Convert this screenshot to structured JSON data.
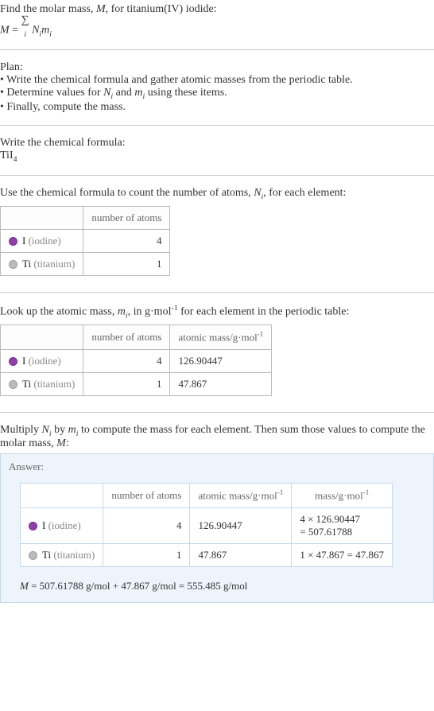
{
  "intro": {
    "line1_a": "Find the molar mass, ",
    "line1_b": ", for titanium(IV) iodide:",
    "formula_lhs": "M",
    "formula_eq": " = ",
    "formula_sum_top": "∑",
    "formula_sum_sub": "i",
    "formula_rhs_a": " N",
    "formula_rhs_b": "m"
  },
  "plan": {
    "heading": "Plan:",
    "b1_a": "• Write the chemical formula and gather atomic masses from the periodic table.",
    "b2_a": "• Determine values for ",
    "b2_b": " and ",
    "b2_c": " using these items.",
    "b3": "• Finally, compute the mass."
  },
  "step_formula": {
    "heading": "Write the chemical formula:",
    "formula_a": "TiI",
    "formula_sub": "4"
  },
  "step_count": {
    "heading_a": "Use the chemical formula to count the number of atoms, ",
    "heading_b": ", for each element:"
  },
  "step_mass": {
    "heading_a": "Look up the atomic mass, ",
    "heading_b": ", in g·mol",
    "heading_c": " for each element in the periodic table:"
  },
  "step_mult": {
    "heading_a": "Multiply ",
    "heading_b": " by ",
    "heading_c": " to compute the mass for each element. Then sum those values to compute the molar mass, ",
    "heading_d": ":"
  },
  "symbols": {
    "M": "M",
    "N": "N",
    "m": "m",
    "i": "i",
    "neg1": "-1"
  },
  "headers": {
    "number_of_atoms": "number of atoms",
    "atomic_mass": "atomic mass/g·mol",
    "mass": "mass/g·mol"
  },
  "elements": {
    "iodine_sym": "I",
    "iodine_name": "(iodine)",
    "titanium_sym": "Ti",
    "titanium_name": "(titanium)"
  },
  "chart_data": {
    "type": "table",
    "rows": [
      {
        "element": "I (iodine)",
        "atoms": 4,
        "atomic_mass": 126.90447,
        "mass_expr": "4 × 126.90447 = 507.61788"
      },
      {
        "element": "Ti (titanium)",
        "atoms": 1,
        "atomic_mass": 47.867,
        "mass_expr": "1 × 47.867 = 47.867"
      }
    ],
    "molar_mass_total": "555.485",
    "molar_mass_expr": "M = 507.61788 g/mol + 47.867 g/mol = 555.485 g/mol"
  },
  "t1": {
    "iodine_atoms": "4",
    "titanium_atoms": "1"
  },
  "t2": {
    "iodine_atoms": "4",
    "iodine_mass": "126.90447",
    "titanium_atoms": "1",
    "titanium_mass": "47.867"
  },
  "t3": {
    "iodine_atoms": "4",
    "iodine_mass": "126.90447",
    "iodine_expr_a": "4 × 126.90447",
    "iodine_expr_b": "= 507.61788",
    "titanium_atoms": "1",
    "titanium_mass": "47.867",
    "titanium_expr": "1 × 47.867 = 47.867"
  },
  "answer": {
    "label": "Answer:",
    "final_a": " = 507.61788 g/mol + 47.867 g/mol = 555.485 g/mol"
  }
}
